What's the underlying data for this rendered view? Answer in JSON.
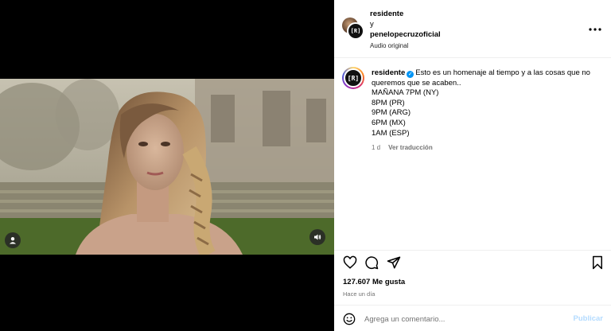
{
  "header": {
    "user1": "residente",
    "connector": "y",
    "user2": "penelopecruzoficial",
    "audio": "Audio original",
    "avatar_logo": "[R]",
    "more_icon": "more-horizontal-icon"
  },
  "caption": {
    "avatar_logo": "[R]",
    "username": "residente",
    "verified_icon": "verified-badge-icon",
    "text": "Esto es un homenaje al tiempo y a las cosas que no queremos que se acaben..",
    "schedule": [
      "MAÑANA 7PM (NY)",
      "8PM (PR)",
      "9PM (ARG)",
      "6PM (MX)",
      "1AM (ESP)"
    ],
    "age": "1 d",
    "translate": "Ver traducción"
  },
  "media": {
    "user_icon": "user-tag-icon",
    "sound_icon": "volume-icon"
  },
  "actions": {
    "like_icon": "heart-icon",
    "comment_icon": "comment-icon",
    "share_icon": "share-icon",
    "save_icon": "bookmark-icon"
  },
  "stats": {
    "likes": "127.607 Me gusta",
    "posted": "Hace un día"
  },
  "comment": {
    "placeholder": "Agrega un comentario...",
    "publish": "Publicar",
    "emoji_icon": "emoji-icon"
  },
  "colors": {
    "accent": "#0095f6",
    "publish_disabled": "#b3dbff",
    "muted": "#737373",
    "media_bg": "#000000"
  }
}
